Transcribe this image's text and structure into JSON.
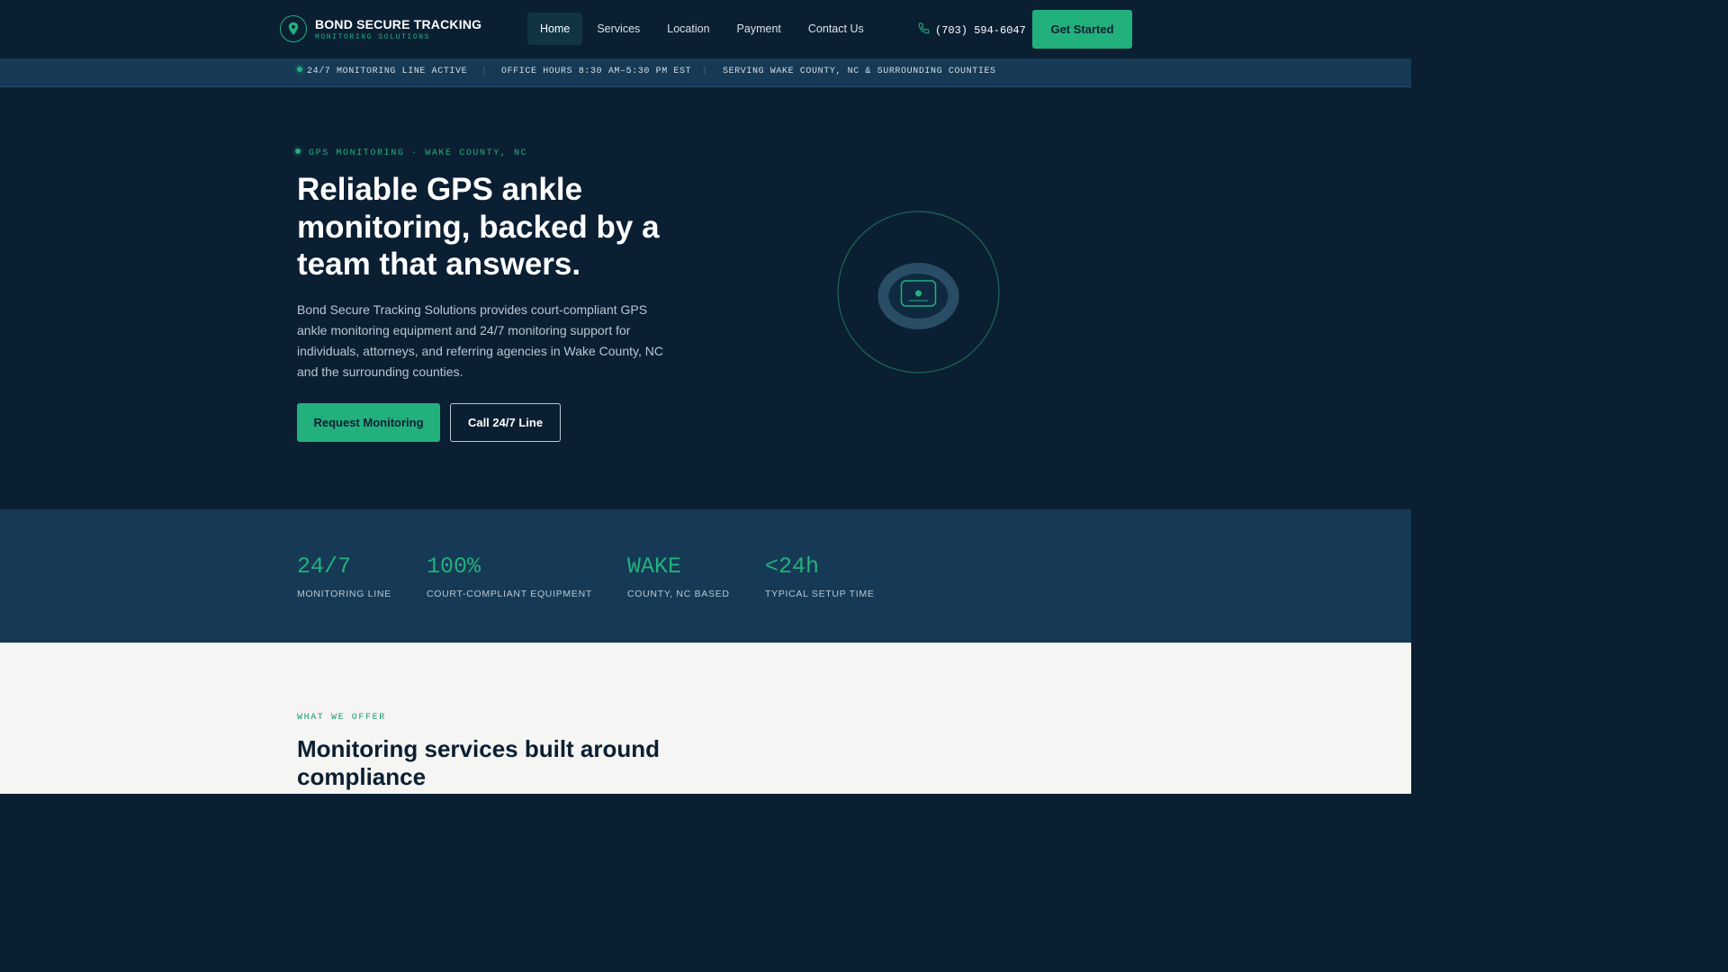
{
  "brand": {
    "name": "BOND SECURE TRACKING",
    "tagline": "MONITORING SOLUTIONS",
    "logo_icon": "map-pin-icon",
    "accent_color": "#22b07d",
    "navy_color": "#0b1f33"
  },
  "nav": {
    "items": [
      {
        "label": "Home",
        "active": true
      },
      {
        "label": "Services",
        "active": false
      },
      {
        "label": "Location",
        "active": false
      },
      {
        "label": "Payment",
        "active": false
      },
      {
        "label": "Contact Us",
        "active": false
      }
    ],
    "phone": "(703) 594-6047",
    "phone_icon": "phone-icon",
    "cta_label": "Get Started"
  },
  "status_bar": {
    "items": [
      "24/7 MONITORING LINE ACTIVE",
      "OFFICE HOURS 8:30 AM–5:30 PM EST",
      "SERVING WAKE COUNTY, NC & SURROUNDING COUNTIES"
    ]
  },
  "hero": {
    "eyebrow": "GPS MONITORING · WAKE COUNTY, NC",
    "title": "Reliable GPS ankle monitoring, backed by a team that answers.",
    "description": "Bond Secure Tracking Solutions provides court-compliant GPS ankle monitoring equipment and 24/7 monitoring support for individuals, attorneys, and referring agencies in Wake County, NC and the surrounding counties.",
    "primary_button": "Request Monitoring",
    "secondary_button": "Call 24/7 Line",
    "illustration_icon": "ankle-monitor-icon"
  },
  "stats": [
    {
      "value": "24/7",
      "label": "MONITORING LINE"
    },
    {
      "value": "100%",
      "label": "COURT-COMPLIANT EQUIPMENT"
    },
    {
      "value": "WAKE",
      "label": "COUNTY, NC BASED"
    },
    {
      "value": "<24h",
      "label": "TYPICAL SETUP TIME"
    }
  ],
  "offer": {
    "eyebrow": "WHAT WE OFFER",
    "title": "Monitoring services built around compliance"
  }
}
